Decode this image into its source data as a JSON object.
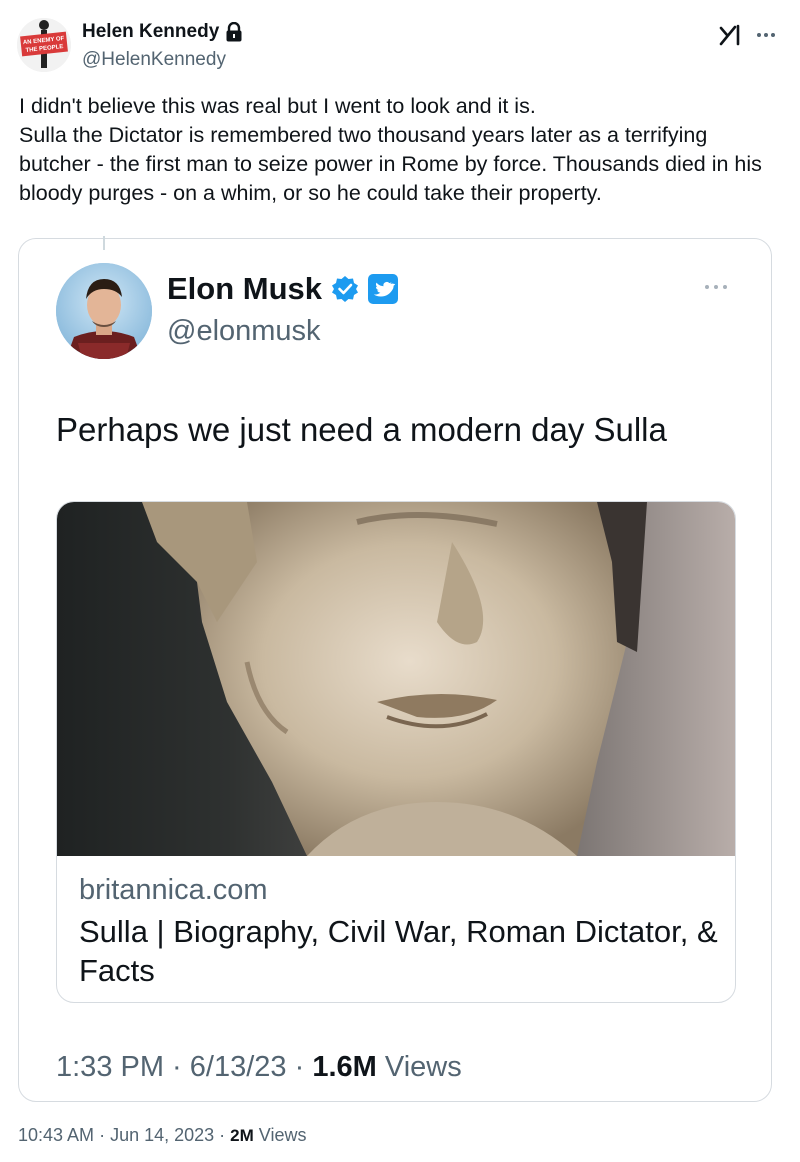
{
  "author": {
    "name": "Helen Kennedy",
    "handle": "@HelenKennedy",
    "avatar_text_line1": "AN ENEMY OF",
    "avatar_text_line2": "THE PEOPLE",
    "avatar_icon": "enemy-of-the-people-sign",
    "protected_icon": "lock-icon"
  },
  "toolbar": {
    "grok_icon": "grok-icon",
    "more_icon": "more-icon"
  },
  "tweet": {
    "line1": "I didn't believe this was real but I went to look and it is.",
    "line2": "Sulla the Dictator is remembered two thousand years later as a terrifying butcher - the first man to seize power in Rome by force. Thousands died in his bloody purges - on a whim, or so he could take their property."
  },
  "quoted": {
    "name": "Elon Musk",
    "handle": "@elonmusk",
    "text": "Perhaps we just need a modern day Sulla",
    "verified_icon": "verified-badge-icon",
    "twitter_icon": "twitter-bird-icon",
    "link": {
      "domain": "britannica.com",
      "title": "Sulla | Biography, Civil War, Roman Dictator, & Facts",
      "image_alt": "marble bust of Sulla"
    },
    "meta": {
      "time": "1:33 PM",
      "date": "6/13/23",
      "views_count": "1.6M",
      "views_label": "Views"
    }
  },
  "footer": {
    "time": "10:43 AM",
    "date": "Jun 14, 2023",
    "views_count": "2M",
    "views_label": "Views"
  },
  "colors": {
    "text": "#0f1419",
    "secondary": "#536471",
    "border": "#d6dbe0",
    "verified": "#1d9bf0"
  }
}
